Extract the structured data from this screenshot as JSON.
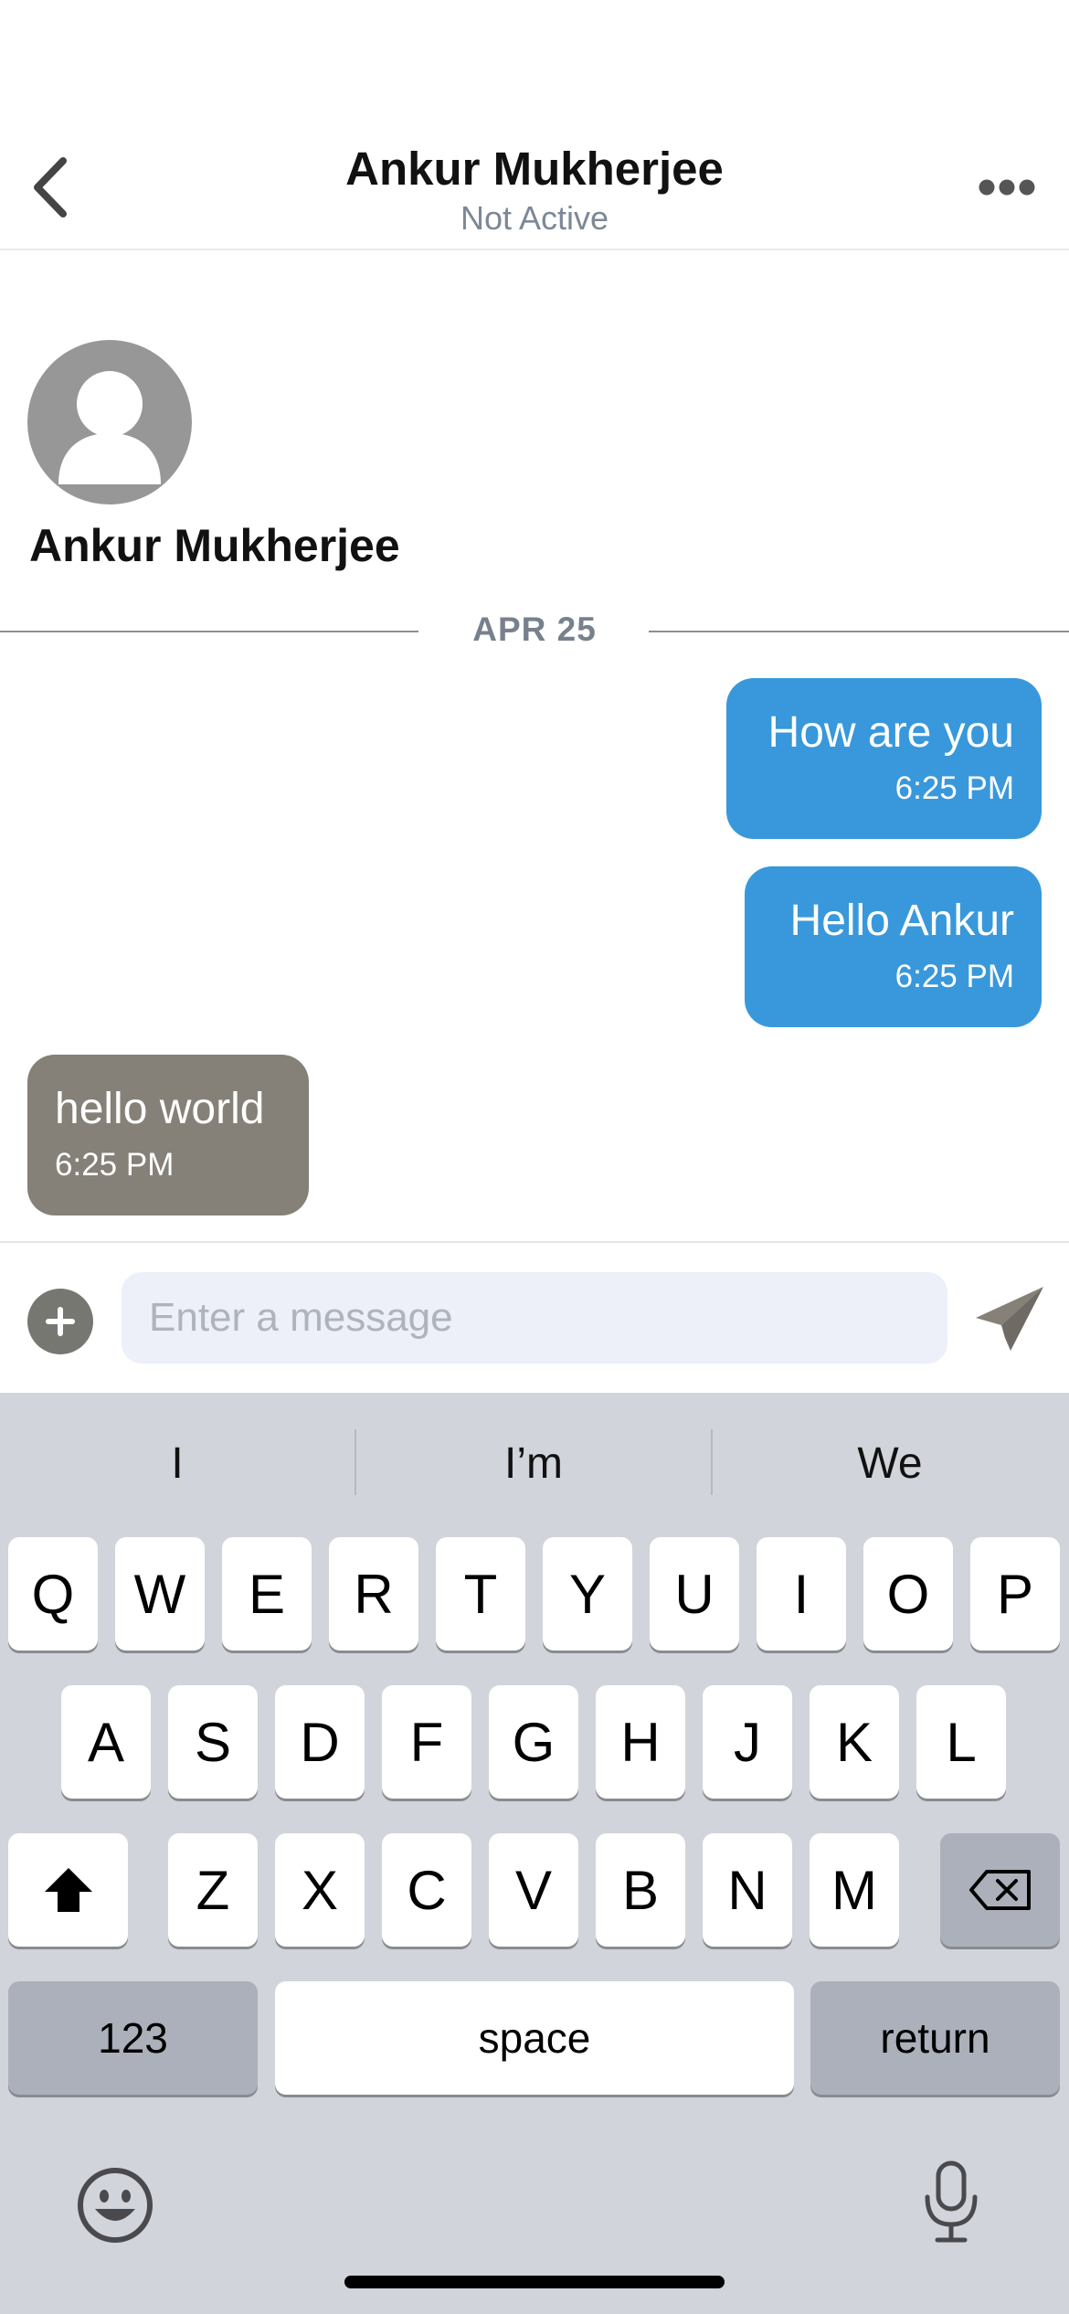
{
  "header": {
    "title": "Ankur Mukherjee",
    "status": "Not Active",
    "back_icon": "chevron-left-icon",
    "more_icon": "ellipsis-icon"
  },
  "profile": {
    "name": "Ankur Mukherjee",
    "avatar_icon": "user-placeholder-icon"
  },
  "date_separator": "APR 25",
  "messages": [
    {
      "direction": "outgoing",
      "text": "How are you",
      "time": "6:25 PM",
      "color": "#3898db"
    },
    {
      "direction": "outgoing",
      "text": "Hello Ankur",
      "time": "6:25 PM",
      "color": "#3898db"
    },
    {
      "direction": "incoming",
      "text": "hello world",
      "time": "6:25 PM",
      "color": "#858078"
    }
  ],
  "composer": {
    "placeholder": "Enter a message",
    "add_icon": "plus-icon",
    "send_icon": "paper-plane-icon"
  },
  "keyboard": {
    "suggestions": [
      "I",
      "I’m",
      "We"
    ],
    "row1": [
      "Q",
      "W",
      "E",
      "R",
      "T",
      "Y",
      "U",
      "I",
      "O",
      "P"
    ],
    "row2": [
      "A",
      "S",
      "D",
      "F",
      "G",
      "H",
      "J",
      "K",
      "L"
    ],
    "row3": [
      "Z",
      "X",
      "C",
      "V",
      "B",
      "N",
      "M"
    ],
    "numbers_label": "123",
    "space_label": "space",
    "return_label": "return",
    "shift_icon": "shift-icon",
    "delete_icon": "backspace-icon",
    "emoji_icon": "emoji-icon",
    "mic_icon": "microphone-icon"
  }
}
